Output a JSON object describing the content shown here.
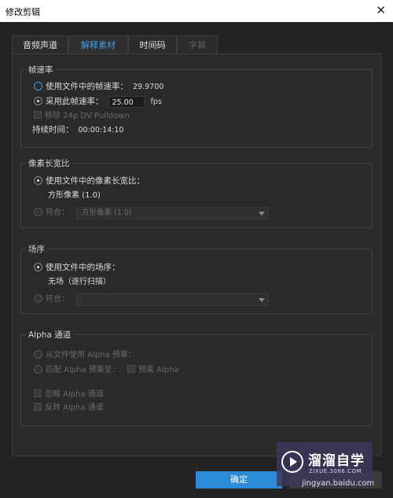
{
  "window": {
    "title": "修改剪辑",
    "close_symbol": "✕"
  },
  "tabs": [
    {
      "label": "音频声道"
    },
    {
      "label": "解释素材"
    },
    {
      "label": "时间码"
    },
    {
      "label": "字幕"
    }
  ],
  "frame_rate": {
    "legend": "帧速率",
    "use_file_label": "使用文件中的帧速率：",
    "use_file_value": "29.9700",
    "assume_label": "采用此帧速率：",
    "assume_value": "25.00",
    "unit": "fps",
    "pulldown_label": "移除 24p DV Pulldown",
    "duration_label": "持续时间：",
    "duration_value": "00:00:14:10"
  },
  "pixel_aspect": {
    "legend": "像素长宽比",
    "use_file_label": "使用文件中的像素长宽比：",
    "file_value": "方形像素 (1.0)",
    "conform_label": "符合：",
    "conform_select": "方形像素 (1.0)"
  },
  "field_order": {
    "legend": "场序",
    "use_file_label": "使用文件中的场序：",
    "file_value": "无场（逐行扫描）",
    "conform_label": "符合：",
    "conform_select": ""
  },
  "alpha": {
    "legend": "Alpha 通道",
    "from_file_label": "从文件使用 Alpha 预乘：",
    "interpret_label": "匹配 Alpha 预乘至：",
    "premultiply_label": "预乘 Alpha",
    "ignore_label": "忽略 Alpha 通道",
    "invert_label": "反转 Alpha 通道"
  },
  "buttons": {
    "ok": "确定"
  },
  "watermark": {
    "name": "溜溜自学",
    "sub": "ZIXUE.3066.COM",
    "url": "jingyan.baidu.com"
  },
  "colors": {
    "accent": "#3fa0e8",
    "button": "#2d8ad6",
    "background": "#232323"
  }
}
